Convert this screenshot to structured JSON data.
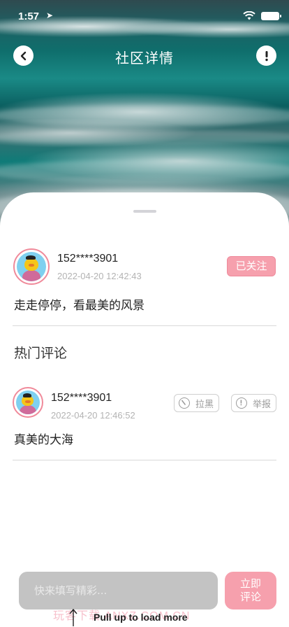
{
  "status_bar": {
    "time": "1:57",
    "location_icon": "location-arrow-icon",
    "wifi_icon": "wifi-icon",
    "battery_icon": "battery-icon"
  },
  "nav": {
    "title": "社区详情",
    "back_icon": "back-arrow-icon",
    "report_icon": "exclamation-icon"
  },
  "post": {
    "username": "152****3901",
    "date": "2022-04-20 12:42:43",
    "follow_label": "已关注",
    "text": "走走停停，看最美的风景"
  },
  "comments_section": {
    "title": "热门评论",
    "items": [
      {
        "username": "152****3901",
        "date": "2022-04-20 12:46:52",
        "block_label": "拉黑",
        "report_label": "举报",
        "text": "真美的大海"
      }
    ]
  },
  "composer": {
    "placeholder": "快来填写精彩...",
    "submit_label": "立即评论"
  },
  "footer": {
    "pull_hint": "Pull up to load more",
    "watermark": "玩客下载 ANXZ.COM.CN"
  },
  "colors": {
    "accent_pink": "#f6a0ad",
    "avatar_ring": "#f08a9a",
    "divider": "#d9d9d9"
  }
}
